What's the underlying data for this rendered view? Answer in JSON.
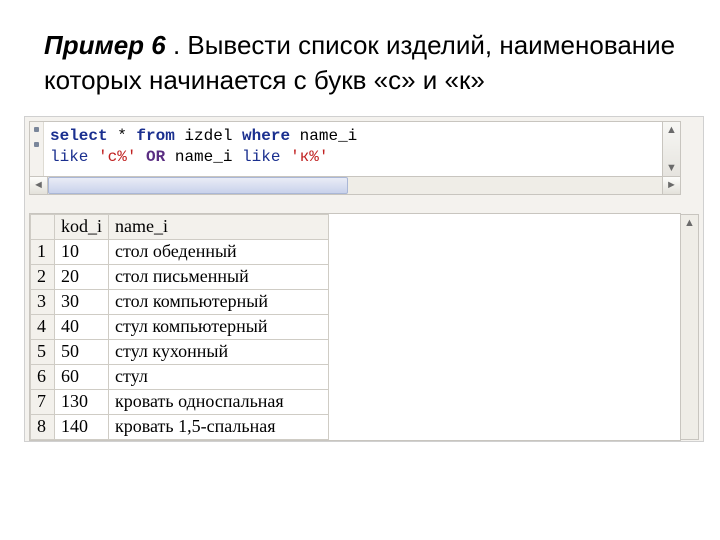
{
  "heading": {
    "lead": "Пример 6",
    "rest": " . Вывести список изделий, наименование которых начинается с букв «с» и «к»"
  },
  "sql": {
    "tokens_line1": [
      {
        "cls": "kw",
        "t": "select"
      },
      {
        "cls": "txt",
        "t": " * "
      },
      {
        "cls": "kw",
        "t": "from"
      },
      {
        "cls": "txt",
        "t": " izdel "
      },
      {
        "cls": "kw",
        "t": "where"
      },
      {
        "cls": "txt",
        "t": " name_i"
      }
    ],
    "tokens_line2": [
      {
        "cls": "kw2",
        "t": "like"
      },
      {
        "cls": "txt",
        "t": " "
      },
      {
        "cls": "str",
        "t": "'с%'"
      },
      {
        "cls": "txt",
        "t": " "
      },
      {
        "cls": "op",
        "t": "OR"
      },
      {
        "cls": "txt",
        "t": " name_i "
      },
      {
        "cls": "kw2",
        "t": "like"
      },
      {
        "cls": "txt",
        "t": " "
      },
      {
        "cls": "str",
        "t": "'к%'"
      }
    ]
  },
  "table": {
    "columns": [
      "kod_i",
      "name_i"
    ],
    "rows": [
      {
        "n": "1",
        "kod": "10",
        "name": "стол обеденный"
      },
      {
        "n": "2",
        "kod": "20",
        "name": "стол письменный"
      },
      {
        "n": "3",
        "kod": "30",
        "name": "стол компьютерный"
      },
      {
        "n": "4",
        "kod": "40",
        "name": "стул компьютерный"
      },
      {
        "n": "5",
        "kod": "50",
        "name": "стул кухонный"
      },
      {
        "n": "6",
        "kod": "60",
        "name": "стул"
      },
      {
        "n": "7",
        "kod": "130",
        "name": "кровать односпальная"
      },
      {
        "n": "8",
        "kod": "140",
        "name": "кровать 1,5-спальная"
      }
    ]
  }
}
